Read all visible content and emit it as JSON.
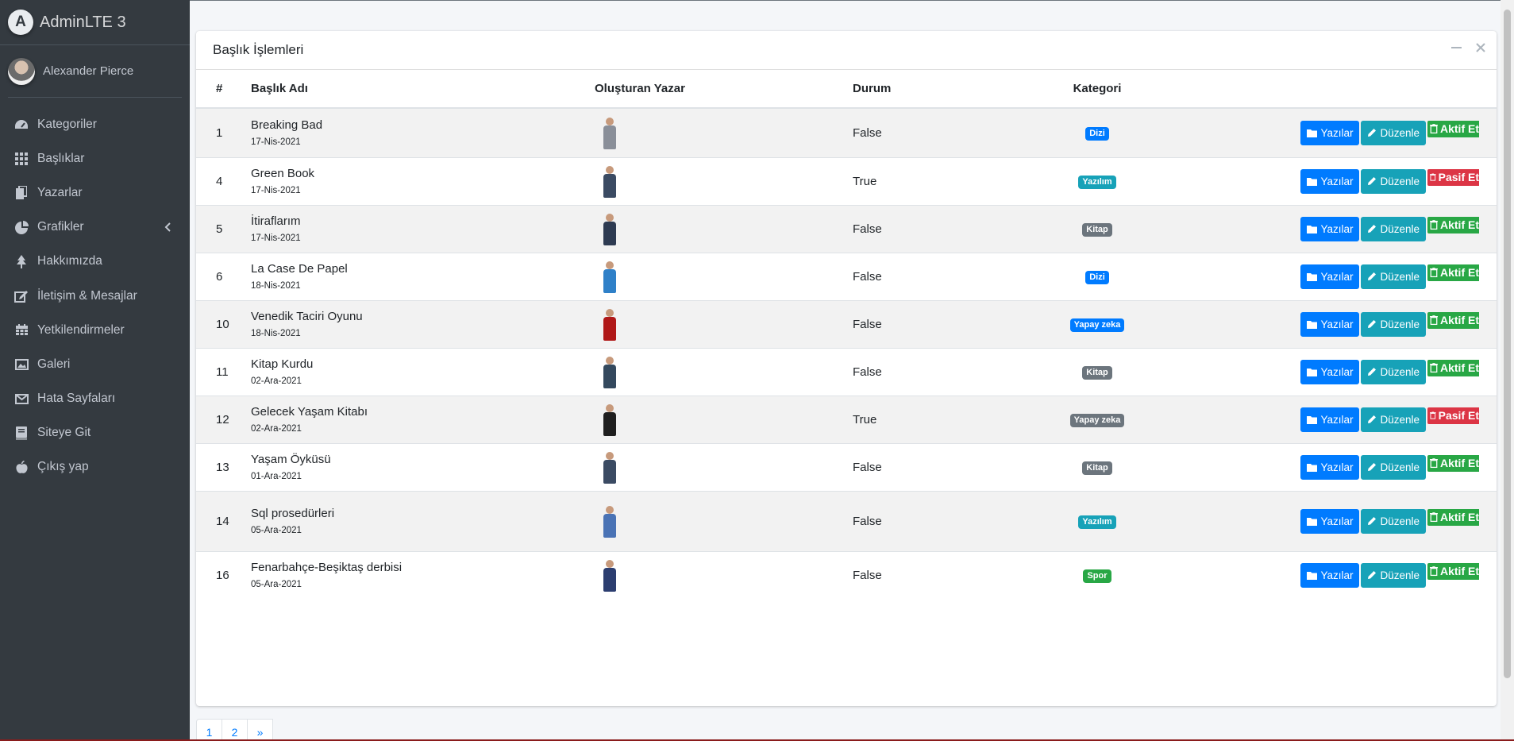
{
  "brand": {
    "title": "AdminLTE 3"
  },
  "user": {
    "name": "Alexander Pierce"
  },
  "sidebar": {
    "items": [
      {
        "label": "Kategoriler",
        "icon": "tachometer-icon"
      },
      {
        "label": "Başlıklar",
        "icon": "grid-icon"
      },
      {
        "label": "Yazarlar",
        "icon": "copy-icon"
      },
      {
        "label": "Grafikler",
        "icon": "pie-chart-icon"
      },
      {
        "label": "Hakkımızda",
        "icon": "tree-icon"
      },
      {
        "label": "İletişim & Mesajlar",
        "icon": "edit-icon"
      },
      {
        "label": "Yetkilendirmeler",
        "icon": "calendar-icon"
      },
      {
        "label": "Galeri",
        "icon": "image-icon"
      },
      {
        "label": "Hata Sayfaları",
        "icon": "envelope-icon"
      },
      {
        "label": "Siteye Git",
        "icon": "book-icon"
      },
      {
        "label": "Çıkış yap",
        "icon": "apple-icon"
      }
    ]
  },
  "card": {
    "title": "Başlık İşlemleri"
  },
  "table": {
    "headers": {
      "id": "#",
      "title": "Başlık Adı",
      "author": "Oluşturan Yazar",
      "status": "Durum",
      "category": "Kategori"
    },
    "buttons": {
      "posts": "Yazılar",
      "edit": "Düzenle",
      "activate": "Aktif Et",
      "deactivate": "Pasif Et"
    },
    "rows": [
      {
        "id": "1",
        "title": "Breaking Bad",
        "date": "17-Nis-2021",
        "status": "False",
        "category": "Dizi",
        "category_color": "#007bff",
        "state_button": "Aktif Et",
        "state_color": "#28a745"
      },
      {
        "id": "4",
        "title": "Green Book",
        "date": "17-Nis-2021",
        "status": "True",
        "category": "Yazılım",
        "category_color": "#17a2b8",
        "state_button": "Pasif Et",
        "state_color": "#dc3545"
      },
      {
        "id": "5",
        "title": "İtiraflarım",
        "date": "17-Nis-2021",
        "status": "False",
        "category": "Kitap",
        "category_color": "#6c757d",
        "state_button": "Aktif Et",
        "state_color": "#28a745"
      },
      {
        "id": "6",
        "title": "La Case De Papel",
        "date": "18-Nis-2021",
        "status": "False",
        "category": "Dizi",
        "category_color": "#007bff",
        "state_button": "Aktif Et",
        "state_color": "#28a745"
      },
      {
        "id": "10",
        "title": "Venedik Taciri Oyunu",
        "date": "18-Nis-2021",
        "status": "False",
        "category": "Yapay zeka",
        "category_color": "#007bff",
        "state_button": "Aktif Et",
        "state_color": "#28a745"
      },
      {
        "id": "11",
        "title": "Kitap Kurdu",
        "date": "02-Ara-2021",
        "status": "False",
        "category": "Kitap",
        "category_color": "#6c757d",
        "state_button": "Aktif Et",
        "state_color": "#28a745"
      },
      {
        "id": "12",
        "title": "Gelecek Yaşam Kitabı",
        "date": "02-Ara-2021",
        "status": "True",
        "category": "Yapay zeka",
        "category_color": "#6c757d",
        "state_button": "Pasif Et",
        "state_color": "#dc3545"
      },
      {
        "id": "13",
        "title": "Yaşam Öyküsü",
        "date": "01-Ara-2021",
        "status": "False",
        "category": "Kitap",
        "category_color": "#6c757d",
        "state_button": "Aktif Et",
        "state_color": "#28a745"
      },
      {
        "id": "14",
        "title": "Sql prosedürleri",
        "date": "05-Ara-2021",
        "status": "False",
        "category": "Yazılım",
        "category_color": "#17a2b8",
        "state_button": "Aktif Et",
        "state_color": "#28a745"
      },
      {
        "id": "16",
        "title": "Fenarbahçe-Beşiktaş derbisi",
        "date": "05-Ara-2021",
        "status": "False",
        "category": "Spor",
        "category_color": "#28a745",
        "state_button": "Aktif Et",
        "state_color": "#28a745"
      }
    ]
  },
  "pagination": {
    "pages": [
      "1",
      "2"
    ],
    "next": "»"
  },
  "colors": {
    "sidebar_bg": "#343a40",
    "primary": "#007bff",
    "info": "#17a2b8",
    "success": "#28a745",
    "danger": "#dc3545",
    "secondary": "#6c757d"
  }
}
